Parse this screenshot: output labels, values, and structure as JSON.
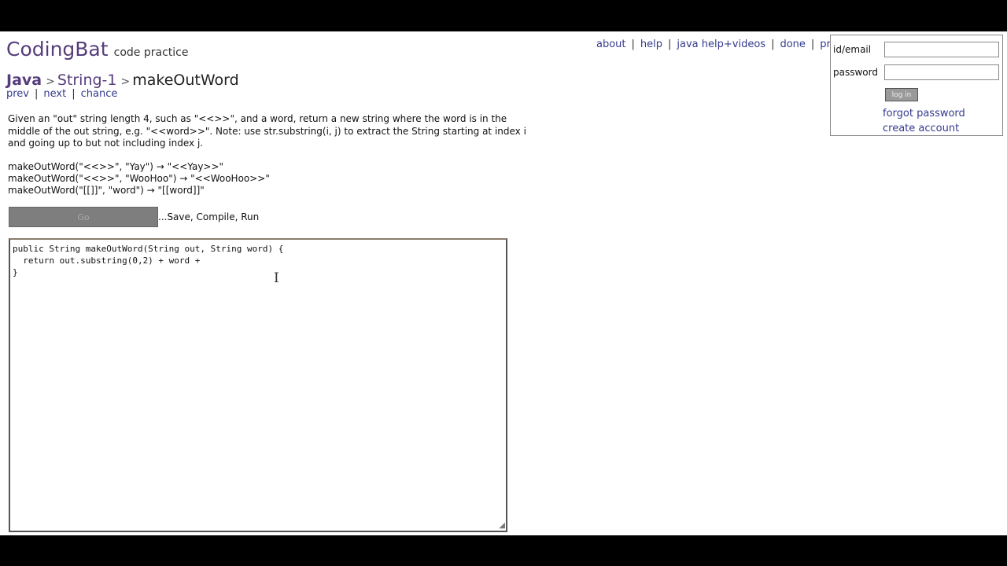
{
  "brand": {
    "name": "CodingBat",
    "tagline": "code practice"
  },
  "breadcrumb": {
    "language": "Java",
    "section": "String-1",
    "problem": "makeOutWord",
    "separator": ">"
  },
  "problem_nav": {
    "prev": "prev",
    "next": "next",
    "chance": "chance"
  },
  "top_nav": {
    "about": "about",
    "help": "help",
    "java_help": "java help+videos",
    "done": "done",
    "prefs": "prefs"
  },
  "login": {
    "id_label": "id/email",
    "password_label": "password",
    "id_value": "",
    "password_value": "",
    "login_button": "log in",
    "forgot_password": "forgot password",
    "create_account": "create account"
  },
  "description": "Given an \"out\" string length 4, such as \"<<>>\", and a word, return a new string where the word is in the middle of the out string, e.g. \"<<word>>\". Note: use str.substring(i, j) to extract the String starting at index i and going up to but not including index j.",
  "examples": [
    "makeOutWord(\"<<>>\", \"Yay\") → \"<<Yay>>\"",
    "makeOutWord(\"<<>>\", \"WooHoo\") → \"<<WooHoo>>\"",
    "makeOutWord(\"[[]]\", \"word\") → \"[[word]]\""
  ],
  "go": {
    "button": "Go",
    "hint": "...Save, Compile, Run"
  },
  "editor": {
    "code": "public String makeOutWord(String out, String word) {\n  return out.substring(0,2) + word +\n}"
  },
  "icons": {
    "text_cursor": "text-cursor-icon",
    "resize_grip": "resize-grip-icon"
  }
}
